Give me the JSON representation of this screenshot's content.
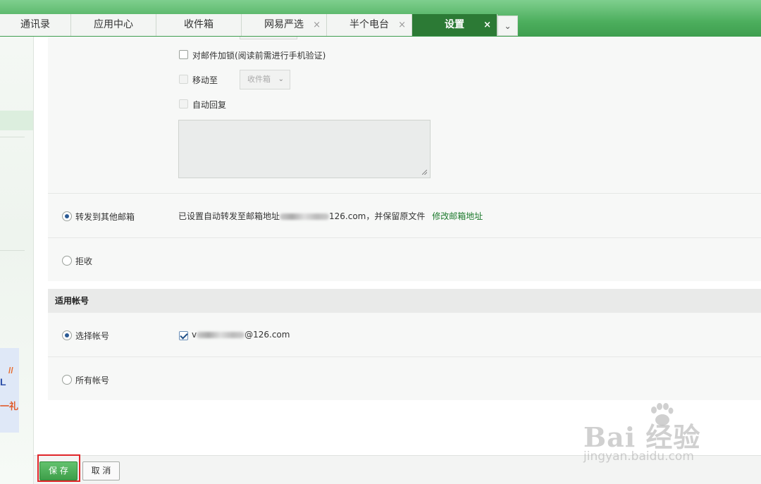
{
  "tabs": [
    {
      "label": "通讯录",
      "closable": false,
      "active": false
    },
    {
      "label": "应用中心",
      "closable": false,
      "active": false
    },
    {
      "label": "收件箱",
      "closable": false,
      "active": false
    },
    {
      "label": "网易严选",
      "closable": true,
      "active": false
    },
    {
      "label": "半个电台",
      "closable": true,
      "active": false
    },
    {
      "label": "设置",
      "closable": true,
      "active": true
    }
  ],
  "tab_close_glyph": "×",
  "tab_dropdown_glyph": "⌄",
  "sidebar": {
    "promo_text_1": "L",
    "promo_text_2": "一礼",
    "promo_mark": "//"
  },
  "options": {
    "lock_mail": "对邮件加锁(阅读前需进行手机验证)",
    "move_to": "移动至",
    "move_to_select": "收件箱",
    "auto_reply": "自动回复",
    "forward": "转发到其他邮箱",
    "forward_desc_prefix": "已设置自动转发至邮箱地址",
    "forward_desc_suffix": "126.com，并保留原文件",
    "forward_link": "修改邮箱地址",
    "reject": "拒收"
  },
  "accounts_section": {
    "title": "适用帐号",
    "select_account": "选择帐号",
    "account_prefix": "v",
    "account_suffix": "@126.com",
    "all_accounts": "所有帐号"
  },
  "buttons": {
    "save": "保 存",
    "cancel": "取 消"
  },
  "watermark": {
    "line1": "Bai  经验",
    "line2": "jingyan.baidu.com"
  },
  "colors": {
    "brand_green": "#2c7a35",
    "link_green": "#1e7a2e",
    "highlight_red": "#e0262a"
  }
}
